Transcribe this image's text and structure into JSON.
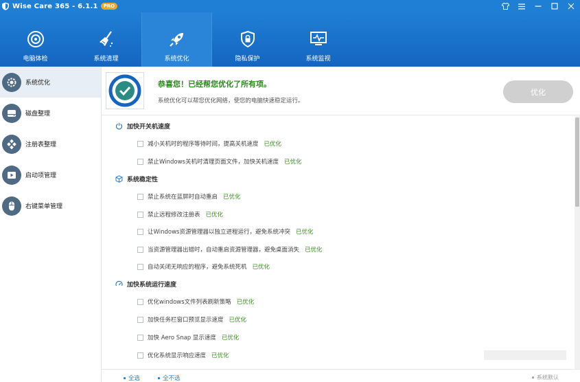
{
  "app": {
    "title": "Wise Care 365 - 6.1.1",
    "badge": "PRO"
  },
  "window_controls": [
    "shirt-icon",
    "menu-icon",
    "minimize-icon",
    "maximize-icon",
    "close-icon"
  ],
  "nav_tabs": [
    {
      "label": "电脑体检",
      "icon": "target-icon"
    },
    {
      "label": "系统清理",
      "icon": "broom-icon"
    },
    {
      "label": "系统优化",
      "icon": "rocket-icon",
      "active": true
    },
    {
      "label": "隐私保护",
      "icon": "shield-lock-icon"
    },
    {
      "label": "系统监视",
      "icon": "monitor-pulse-icon"
    }
  ],
  "sidebar": {
    "items": [
      {
        "label": "系统优化",
        "icon": "gear-icon",
        "active": true
      },
      {
        "label": "磁盘整理",
        "icon": "disk-icon"
      },
      {
        "label": "注册表整理",
        "icon": "registry-icon"
      },
      {
        "label": "启动项管理",
        "icon": "play-icon"
      },
      {
        "label": "右键菜单管理",
        "icon": "mouse-icon"
      }
    ]
  },
  "status": {
    "title": "恭喜您！已经帮您优化了所有项。",
    "description": "系统优化可以帮您优化网络，使您的电脑快速稳定运行。",
    "button": "优化"
  },
  "sections": [
    {
      "title": "加快开关机速度",
      "icon": "power-icon",
      "items": [
        {
          "text": "减小关机时的程序等待时间，提高关机速度",
          "status": "已优化"
        },
        {
          "text": "禁止Windows关机时清理页面文件，加快关机速度",
          "status": "已优化"
        }
      ]
    },
    {
      "title": "系统稳定性",
      "icon": "cube-icon",
      "items": [
        {
          "text": "禁止系统在蓝屏时自动重启",
          "status": "已优化"
        },
        {
          "text": "禁止远程修改注册表",
          "status": "已优化"
        },
        {
          "text": "让Windows资源管理器以独立进程运行，避免系统冲突",
          "status": "已优化"
        },
        {
          "text": "当资源管理器出错时，自动重启资源管理器，避免桌面消失",
          "status": "已优化"
        },
        {
          "text": "自动关闭无响应的程序，避免系统死机",
          "status": "已优化"
        }
      ]
    },
    {
      "title": "加快系统运行速度",
      "icon": "speedometer-icon",
      "items": [
        {
          "text": "优化windows文件列表刷新策略",
          "status": "已优化"
        },
        {
          "text": "加快任务栏窗口预览显示速度",
          "status": "已优化"
        },
        {
          "text": "加快 Aero Snap 显示速度",
          "status": "已优化"
        },
        {
          "text": "优化系统显示响应速度",
          "status": "已优化"
        }
      ]
    }
  ],
  "footer": {
    "select_all": "全选",
    "select_none": "全不选",
    "default": "系统默认"
  },
  "colors": {
    "accent": "#1f7fd4",
    "header_dark": "#1565c0",
    "success": "#3b8e22",
    "disabled_button": "#d0d0d0"
  }
}
